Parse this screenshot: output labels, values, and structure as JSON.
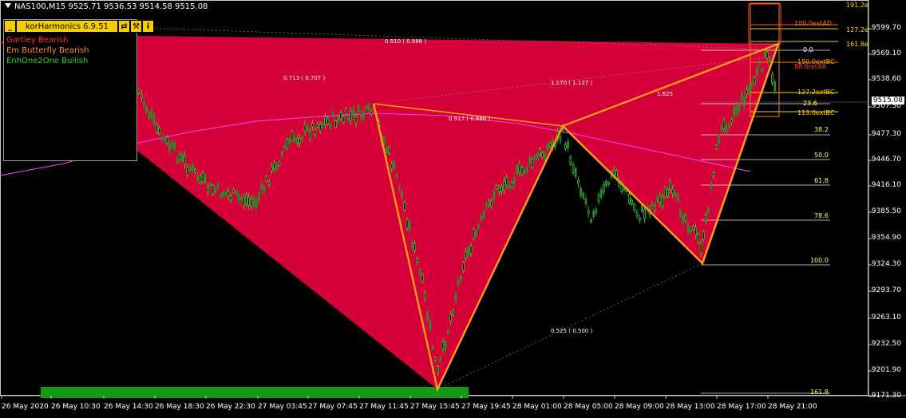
{
  "symbol_title": "NAS100,M15  9525.71 9536.53 9514.58 9515.08",
  "toolbar": {
    "minimize": "_",
    "title": "korHarmonics 6.9.51",
    "swap": "⇄",
    "tools": "⚒",
    "info": "i"
  },
  "legend": [
    {
      "label": "Gartley Bearish",
      "color": "#ff2a2a"
    },
    {
      "label": "Em Butterfly Bearish",
      "color": "#ff8c1a"
    },
    {
      "label": "EnhOne2One Bullish",
      "color": "#2ad42a"
    }
  ],
  "current_price": "9515.08",
  "y_axis": [
    "9599.70",
    "9569.10",
    "9538.60",
    "9507.30",
    "9477.30",
    "9446.70",
    "9416.10",
    "9385.50",
    "9354.90",
    "9324.30",
    "9293.70",
    "9263.10",
    "9232.50",
    "9201.90",
    "9171.30"
  ],
  "x_axis": [
    "26 May 2020",
    "26 May 10:30",
    "26 May 14:30",
    "26 May 18:30",
    "26 May 22:30",
    "27 May 03:45",
    "27 May 07:45",
    "27 May 11:45",
    "27 May 15:45",
    "27 May 19:45",
    "28 May 01:00",
    "28 May 05:00",
    "28 May 09:00",
    "28 May 13:00",
    "28 May 17:00",
    "28 May 21:00"
  ],
  "fib_levels": [
    "0.0",
    "23.6",
    "38.2",
    "50.0",
    "61.8",
    "78.6",
    "100.0",
    "161.8"
  ],
  "ext_labels": [
    "191.2e",
    "127.2e",
    "161.8e",
    "150.0extBC",
    "127.2extBC",
    "113.0extBC",
    "100.0extAD",
    "88.6retXA"
  ],
  "ratios": [
    "0.910 ( 0.886 )",
    "0.713 ( 0.707 )",
    "1.170 ( 1.127 )",
    "0.917 ( 0.886 )",
    "0.525 ( 0.500 )",
    "1.625"
  ],
  "colors": {
    "pattern_fill": "#e0003a",
    "leg_line": "#ff9a1a",
    "bull_candle": "#31e531",
    "bear_candle": "#2e8b2e",
    "ma_line": "#ff40ff",
    "fib_line": "#e6e6e6",
    "fib_label": "#ffff4d",
    "ext_label": "#ffd400"
  },
  "chart_data": {
    "type": "candlestick",
    "title": "NAS100,M15",
    "ylim": [
      9165,
      9625
    ],
    "pattern_points": [
      {
        "time": "27 May 11:45",
        "price": 9512
      },
      {
        "time": "27 May 15:45",
        "price": 9178
      },
      {
        "time": "28 May 01:00",
        "price": 9487
      },
      {
        "time": "28 May 13:00",
        "price": 9330
      },
      {
        "time": "28 May 17:00",
        "price": 9580
      }
    ]
  }
}
